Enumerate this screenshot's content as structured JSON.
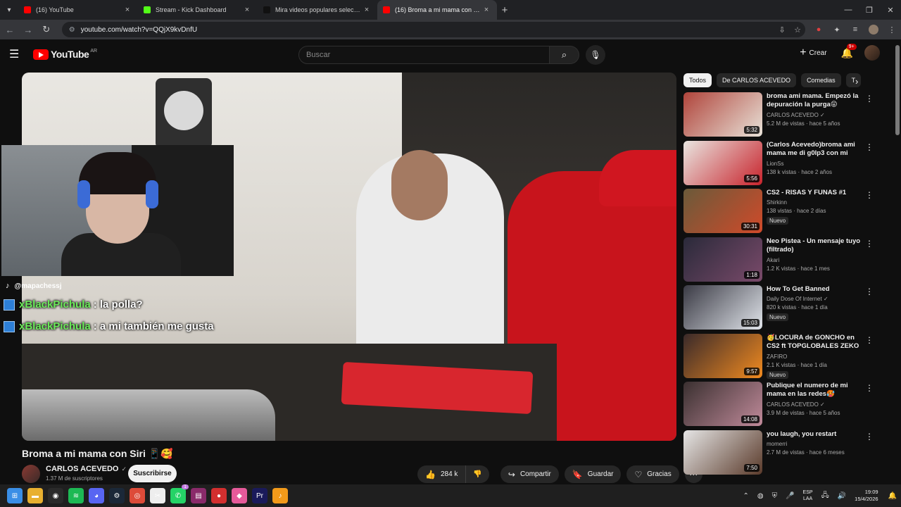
{
  "browser": {
    "tabs": [
      {
        "title": "(16) YouTube",
        "color": "#ff0000",
        "active": false
      },
      {
        "title": "Stream - Kick Dashboard",
        "color": "#53fc18",
        "active": false
      },
      {
        "title": "Mira videos populares seleccion",
        "color": "#111111",
        "active": false
      },
      {
        "title": "(16) Broma a mi mama con Siri",
        "color": "#ff0000",
        "active": true
      }
    ],
    "url": "youtube.com/watch?v=QQjX9kvDnfU"
  },
  "youtube": {
    "logo_text": "YouTube",
    "country_code": "AR",
    "search_placeholder": "Buscar",
    "create_label": "Crear",
    "notification_count": "9+"
  },
  "stream_overlay": {
    "handle": "@mapachessj",
    "chat": [
      {
        "user": "xBlackPichula",
        "message": ": la polla?"
      },
      {
        "user": "xBlackPichula",
        "message": ": a mi también me gusta"
      }
    ]
  },
  "video": {
    "title": "Broma a mi mama con Siri 📱🥰",
    "channel": "CARLOS ACEVEDO",
    "subscribers": "1.37 M de suscriptores",
    "subscribe_label": "Suscribirse",
    "likes": "284 k",
    "share_label": "Compartir",
    "save_label": "Guardar",
    "thanks_label": "Gracias"
  },
  "sidebar": {
    "chips": [
      "Todos",
      "De CARLOS ACEVEDO",
      "Comedias",
      "T"
    ],
    "recommendations": [
      {
        "title": "broma ami mama.  Empezó la depuración la purga😝",
        "channel": "CARLOS ACEVEDO",
        "verified": true,
        "meta": "5.2 M de vistas · hace 5 años",
        "duration": "5:32",
        "badge": "",
        "thumb": [
          "#b0443b",
          "#e8e2d8"
        ]
      },
      {
        "title": "(Carlos Acevedo)broma ami mama me di g0lp3 con mi p1...",
        "channel": "LionSs",
        "verified": false,
        "meta": "138 k vistas · hace 2 años",
        "duration": "5:56",
        "badge": "",
        "thumb": [
          "#e9e6e1",
          "#c8232c"
        ]
      },
      {
        "title": "CS2 - RISAS Y FUNAS #1",
        "channel": "Shirkinn",
        "verified": false,
        "meta": "138 vistas · hace 2 días",
        "duration": "30:31",
        "badge": "Nuevo",
        "thumb": [
          "#6a5a3a",
          "#d04a2a"
        ]
      },
      {
        "title": "Neo Pistea - Un mensaje tuyo (filtrado)",
        "channel": "Akari",
        "verified": false,
        "meta": "1.2 K vistas · hace 1 mes",
        "duration": "1:18",
        "badge": "",
        "thumb": [
          "#2a2a3a",
          "#7a4a6a"
        ]
      },
      {
        "title": "How To Get Banned",
        "channel": "Daily Dose Of Internet",
        "verified": true,
        "meta": "820 k vistas · hace 1 día",
        "duration": "15:03",
        "badge": "Nuevo",
        "thumb": [
          "#3a3a44",
          "#e0e4ea"
        ]
      },
      {
        "title": "🥳LOCURA de GONCHO en CS2 ft TOPGLOBALES ZEKO ...",
        "channel": "ZAFIRO",
        "verified": false,
        "meta": "2.1 K vistas · hace 1 día",
        "duration": "9:57",
        "badge": "Nuevo",
        "thumb": [
          "#3a2a2a",
          "#f08a20"
        ]
      },
      {
        "title": "Publique el numero de mi mama en las redes🥵",
        "channel": "CARLOS ACEVEDO",
        "verified": true,
        "meta": "3.9 M de vistas · hace 5 años",
        "duration": "14:08",
        "badge": "",
        "thumb": [
          "#3a3030",
          "#c08a9a"
        ]
      },
      {
        "title": "you laugh, you restart",
        "channel": "momerri",
        "verified": false,
        "meta": "2.7 M de vistas · hace 6 meses",
        "duration": "7:50",
        "badge": "",
        "thumb": [
          "#e6e6e6",
          "#5a3a2a"
        ]
      }
    ]
  },
  "taskbar": {
    "icons": [
      {
        "name": "windows-start-icon",
        "color": "#3a8ee6",
        "glyph": "⊞"
      },
      {
        "name": "file-explorer-icon",
        "color": "#e8b030",
        "glyph": "▬"
      },
      {
        "name": "obs-icon",
        "color": "#2a2a2a",
        "glyph": "◉"
      },
      {
        "name": "spotify-icon",
        "color": "#1db954",
        "glyph": "≋"
      },
      {
        "name": "discord-icon",
        "color": "#5865f2",
        "glyph": "◕"
      },
      {
        "name": "steam-icon",
        "color": "#1b2838",
        "glyph": "⚙"
      },
      {
        "name": "chrome-icon",
        "color": "#dd4b39",
        "glyph": "◎"
      },
      {
        "name": "capcut-icon",
        "color": "#eeeeee",
        "glyph": "✂"
      },
      {
        "name": "whatsapp-icon",
        "color": "#25d366",
        "glyph": "✆"
      },
      {
        "name": "winrar-icon",
        "color": "#8a2a6a",
        "glyph": "▤"
      },
      {
        "name": "riot-icon",
        "color": "#d32f2f",
        "glyph": "●"
      },
      {
        "name": "app-icon",
        "color": "#e65a9a",
        "glyph": "◆"
      },
      {
        "name": "premiere-icon",
        "color": "#1a1a5a",
        "glyph": "Pr"
      },
      {
        "name": "fl-studio-icon",
        "color": "#f29a1a",
        "glyph": "♪"
      }
    ],
    "whatsapp_badge": "1",
    "lang_top": "ESP",
    "lang_bottom": "LAA",
    "time": "19:09",
    "date": "15/4/2026"
  }
}
